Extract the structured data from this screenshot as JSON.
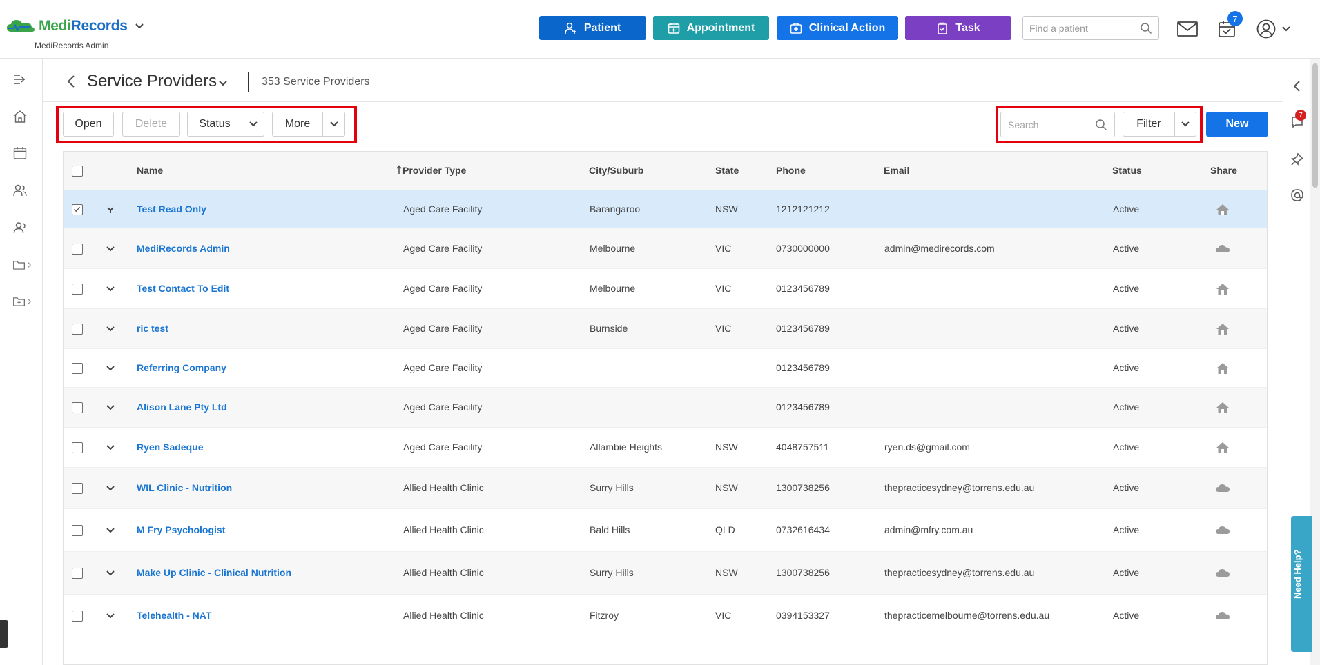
{
  "header": {
    "logo_medi": "Medi",
    "logo_records": "Records",
    "logo_subtitle": "MediRecords Admin",
    "buttons": {
      "patient": "Patient",
      "appointment": "Appointment",
      "clinical_action": "Clinical Action",
      "task": "Task"
    },
    "find_placeholder": "Find a patient",
    "tasks_badge": "7",
    "colors": {
      "patient": "#0b66cc",
      "appointment": "#1f9ea8",
      "clinical_action": "#1473e6",
      "task": "#7b3fc4"
    }
  },
  "page": {
    "title": "Service Providers",
    "count": "353 Service Providers"
  },
  "toolbar": {
    "open": "Open",
    "delete": "Delete",
    "status": "Status",
    "more": "More",
    "search_placeholder": "Search",
    "filter": "Filter",
    "new": "New"
  },
  "right_rail": {
    "chat_badge": "7",
    "need_help": "Need Help?"
  },
  "table": {
    "columns": {
      "name": "Name",
      "provider_type": "Provider Type",
      "city": "City/Suburb",
      "state": "State",
      "phone": "Phone",
      "email": "Email",
      "status": "Status",
      "share": "Share"
    },
    "rows": [
      {
        "name": "Test Read Only",
        "type": "Aged Care Facility",
        "city": "Barangaroo",
        "state": "NSW",
        "phone": "1212121212",
        "email": "",
        "status": "Active",
        "share": "home-icon",
        "checked": true
      },
      {
        "name": "MediRecords Admin",
        "type": "Aged Care Facility",
        "city": "Melbourne",
        "state": "VIC",
        "phone": "0730000000",
        "email": "admin@medirecords.com",
        "status": "Active",
        "share": "cloud-icon",
        "checked": false
      },
      {
        "name": "Test Contact To Edit",
        "type": "Aged Care Facility",
        "city": "Melbourne",
        "state": "VIC",
        "phone": "0123456789",
        "email": "",
        "status": "Active",
        "share": "home-icon",
        "checked": false
      },
      {
        "name": "ric test",
        "type": "Aged Care Facility",
        "city": "Burnside",
        "state": "VIC",
        "phone": "0123456789",
        "email": "",
        "status": "Active",
        "share": "home-icon",
        "checked": false
      },
      {
        "name": "Referring Company",
        "type": "Aged Care Facility",
        "city": "",
        "state": "",
        "phone": "0123456789",
        "email": "",
        "status": "Active",
        "share": "home-icon",
        "checked": false
      },
      {
        "name": "Alison Lane Pty Ltd",
        "type": "Aged Care Facility",
        "city": "",
        "state": "",
        "phone": "0123456789",
        "email": "",
        "status": "Active",
        "share": "home-icon",
        "checked": false
      },
      {
        "name": "Ryen Sadeque",
        "type": "Aged Care Facility",
        "city": "Allambie Heights",
        "state": "NSW",
        "phone": "4048757511",
        "email": "ryen.ds@gmail.com",
        "status": "Active",
        "share": "home-icon",
        "checked": false
      },
      {
        "name": "WIL Clinic - Nutrition",
        "type": "Allied Health Clinic",
        "city": "Surry Hills",
        "state": "NSW",
        "phone": "1300738256",
        "email": "thepracticesydney@torrens.edu.au",
        "status": "Active",
        "share": "cloud-icon",
        "checked": false
      },
      {
        "name": "M Fry Psychologist",
        "type": "Allied Health Clinic",
        "city": "Bald Hills",
        "state": "QLD",
        "phone": "0732616434",
        "email": "admin@mfry.com.au",
        "status": "Active",
        "share": "cloud-icon",
        "checked": false
      },
      {
        "name": "Make Up Clinic - Clinical Nutrition",
        "type": "Allied Health Clinic",
        "city": "Surry Hills",
        "state": "NSW",
        "phone": "1300738256",
        "email": "thepracticesydney@torrens.edu.au",
        "status": "Active",
        "share": "cloud-icon",
        "checked": false
      },
      {
        "name": "Telehealth - NAT",
        "type": "Allied Health Clinic",
        "city": "Fitzroy",
        "state": "VIC",
        "phone": "0394153327",
        "email": "thepracticemelbourne@torrens.edu.au",
        "status": "Active",
        "share": "cloud-icon",
        "checked": false
      }
    ]
  }
}
